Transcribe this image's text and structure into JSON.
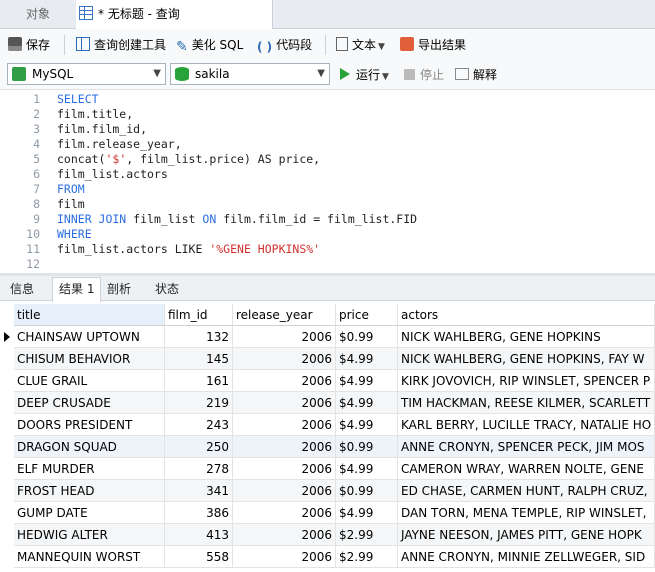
{
  "tabs": {
    "object": "对象",
    "query": "* 无标题 - 查询"
  },
  "toolbar": {
    "save": "保存",
    "query_builder": "查询创建工具",
    "beautify": "美化 SQL",
    "snippet": "代码段",
    "text": "文本",
    "export": "导出结果"
  },
  "connection": {
    "engine": "MySQL",
    "database": "sakila"
  },
  "actions": {
    "run": "运行",
    "stop": "停止",
    "explain": "解释"
  },
  "editor": {
    "line_numbers": [
      "1",
      "2",
      "3",
      "4",
      "5",
      "6",
      "7",
      "8",
      "9",
      "10",
      "11",
      "12"
    ]
  },
  "result_tabs": [
    "信息",
    "结果 1",
    "剖析",
    "状态"
  ],
  "grid": {
    "columns": [
      "title",
      "film_id",
      "release_year",
      "price",
      "actors"
    ],
    "rows": [
      [
        "CHAINSAW UPTOWN",
        "132",
        "2006",
        "$0.99",
        "NICK WAHLBERG, GENE HOPKINS"
      ],
      [
        "CHISUM BEHAVIOR",
        "145",
        "2006",
        "$4.99",
        "NICK WAHLBERG, GENE HOPKINS, FAY W"
      ],
      [
        "CLUE GRAIL",
        "161",
        "2006",
        "$4.99",
        "KIRK JOVOVICH, RIP WINSLET, SPENCER P"
      ],
      [
        "DEEP CRUSADE",
        "219",
        "2006",
        "$4.99",
        "TIM HACKMAN, REESE KILMER, SCARLETT"
      ],
      [
        "DOORS PRESIDENT",
        "243",
        "2006",
        "$4.99",
        "KARL BERRY, LUCILLE TRACY, NATALIE HO"
      ],
      [
        "DRAGON SQUAD",
        "250",
        "2006",
        "$0.99",
        "ANNE CRONYN, SPENCER PECK, JIM MOS"
      ],
      [
        "ELF MURDER",
        "278",
        "2006",
        "$4.99",
        "CAMERON WRAY, WARREN NOLTE, GENE"
      ],
      [
        "FROST HEAD",
        "341",
        "2006",
        "$0.99",
        "ED CHASE, CARMEN HUNT, RALPH CRUZ,"
      ],
      [
        "GUMP DATE",
        "386",
        "2006",
        "$4.99",
        "DAN TORN, MENA TEMPLE, RIP WINSLET,"
      ],
      [
        "HEDWIG ALTER",
        "413",
        "2006",
        "$2.99",
        "JAYNE NEESON, JAMES PITT, GENE HOPK"
      ],
      [
        "MANNEQUIN WORST",
        "558",
        "2006",
        "$2.99",
        "ANNE CRONYN, MINNIE ZELLWEGER, SID"
      ]
    ]
  }
}
